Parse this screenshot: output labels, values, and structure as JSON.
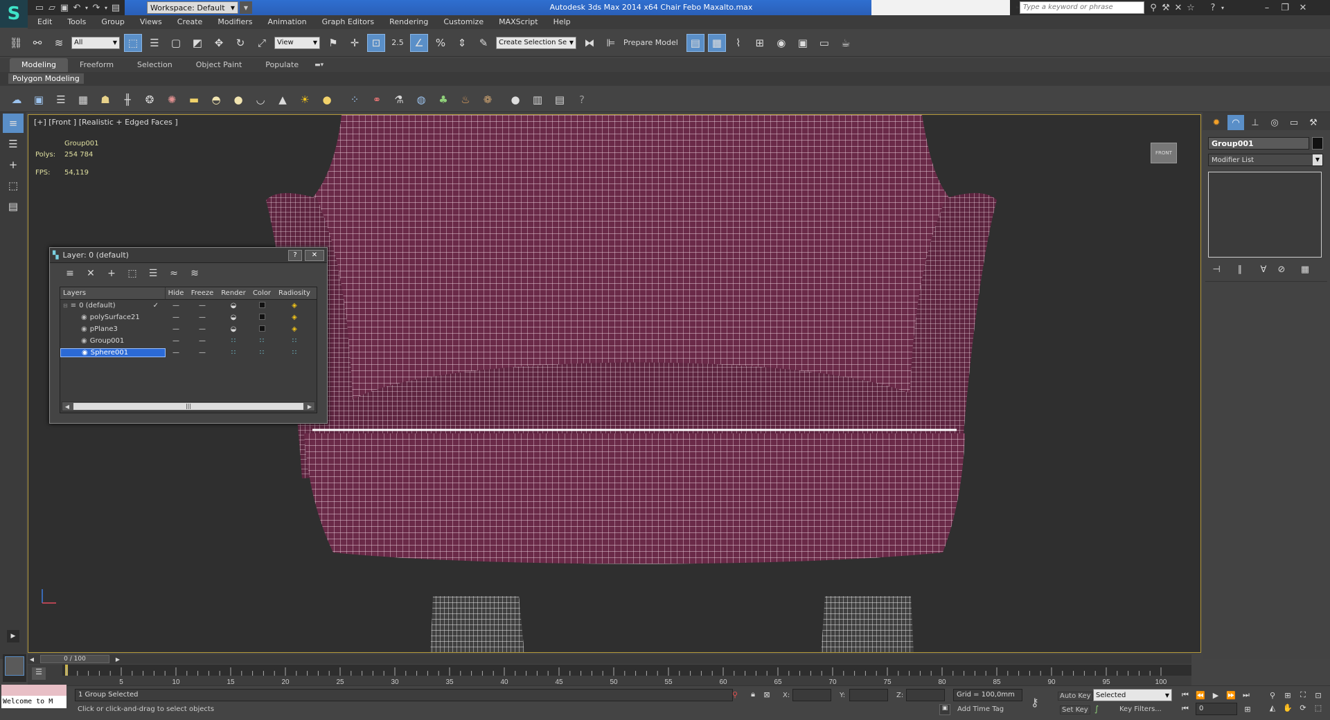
{
  "titlebar": {
    "title": "Autodesk 3ds Max  2014 x64    Chair Febo Maxalto.max",
    "workspace": "Workspace: Default",
    "search_placeholder": "Type a keyword or phrase"
  },
  "menu": [
    "Edit",
    "Tools",
    "Group",
    "Views",
    "Create",
    "Modifiers",
    "Animation",
    "Graph Editors",
    "Rendering",
    "Customize",
    "MAXScript",
    "Help"
  ],
  "toolbar": {
    "filter": "All",
    "refcoord": "View",
    "snap_label": "2.5",
    "selection_set": "Create Selection Se",
    "prepare_model": "Prepare Model"
  },
  "ribbon": {
    "tabs": [
      "Modeling",
      "Freeform",
      "Selection",
      "Object Paint",
      "Populate"
    ],
    "panel": "Polygon Modeling"
  },
  "viewport": {
    "label": "[+] [Front ] [Realistic + Edged Faces ]",
    "object": "Group001",
    "polys_label": "Polys:",
    "polys": "254 784",
    "fps_label": "FPS:",
    "fps": "54,119",
    "viewcube": "FRONT"
  },
  "layer_dialog": {
    "title": "Layer: 0 (default)",
    "help": "?",
    "close": "✕",
    "columns": [
      "Layers",
      "Hide",
      "Freeze",
      "Render",
      "Color",
      "Radiosity"
    ],
    "rows": [
      {
        "name": "0 (default)",
        "hide": "—",
        "freeze": "—",
        "render": "◒",
        "color": "#111111",
        "radiosity": "◈"
      },
      {
        "name": "polySurface21",
        "hide": "—",
        "freeze": "—",
        "render": "◒",
        "color": "#111111",
        "radiosity": "◈"
      },
      {
        "name": "pPlane3",
        "hide": "—",
        "freeze": "—",
        "render": "◒",
        "color": "#111111",
        "radiosity": "◈"
      },
      {
        "name": "Group001",
        "hide": "—",
        "freeze": "—",
        "render": "∷",
        "color": "#111111",
        "radiosity": "∷"
      },
      {
        "name": "Sphere001",
        "hide": "—",
        "freeze": "—",
        "render": "∷",
        "color": "#111111",
        "radiosity": "∷"
      }
    ],
    "active_check": "✓",
    "scroll_grip": "|||"
  },
  "command_panel": {
    "object_name": "Group001",
    "modifier_list": "Modifier List"
  },
  "timeline": {
    "frame": "0 / 100",
    "ticks": [
      5,
      10,
      15,
      20,
      25,
      30,
      35,
      40,
      45,
      50,
      55,
      60,
      65,
      70,
      75,
      80,
      85,
      90,
      95,
      100
    ]
  },
  "status": {
    "welcome": "Welcome to M",
    "selected": "1 Group Selected",
    "prompt": "Click or click-and-drag to select objects",
    "x_label": "X:",
    "y_label": "Y:",
    "z_label": "Z:",
    "grid": "Grid = 100,0mm",
    "add_time_tag": "Add Time Tag",
    "auto_key": "Auto Key",
    "set_key": "Set Key",
    "key_mode": "Selected",
    "key_filters": "Key Filters...",
    "frame_field": "0"
  },
  "colors": {
    "viewport_border": "#b59a3a",
    "selection": "#2b6ad6",
    "fabric": "#6a2a48"
  }
}
